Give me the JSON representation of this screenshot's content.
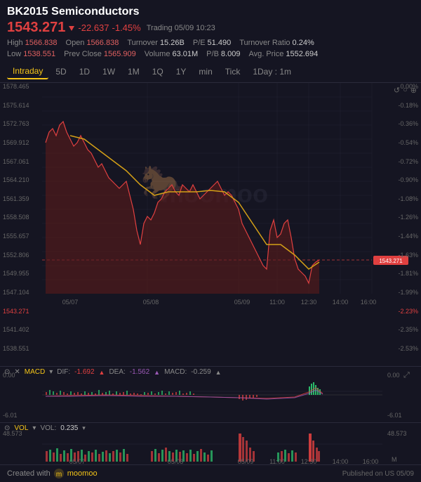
{
  "header": {
    "title": "BK2015 Semiconductors",
    "price": "1543.271",
    "change_amount": "-22.637",
    "change_pct": "-1.45%",
    "status": "Trading",
    "date_time": "05/09 10:23",
    "high_label": "High",
    "high_val": "1566.838",
    "low_label": "Low",
    "low_val": "1538.551",
    "open_label": "Open",
    "open_val": "1566.838",
    "prev_close_label": "Prev Close",
    "prev_close_val": "1565.909",
    "turnover_label": "Turnover",
    "turnover_val": "15.26B",
    "volume_label": "Volume",
    "volume_val": "63.01M",
    "pe_label": "P/E",
    "pe_val": "51.490",
    "pb_label": "P/B",
    "pb_val": "8.009",
    "turnover_ratio_label": "Turnover Ratio",
    "turnover_ratio_val": "0.24%",
    "avg_price_label": "Avg. Price",
    "avg_price_val": "1552.694"
  },
  "tabs": {
    "items": [
      "Intraday",
      "5D",
      "1D",
      "1W",
      "1M",
      "1Q",
      "1Y",
      "min",
      "Tick",
      "1Day : 1m"
    ],
    "active": "Intraday"
  },
  "chart": {
    "y_labels_left": [
      "1578.465",
      "1575.614",
      "1572.763",
      "1569.912",
      "1567.061",
      "1564.210",
      "1561.359",
      "1558.508",
      "1555.657",
      "1552.806",
      "1549.955",
      "1547.104",
      "1543.271 (dashed)",
      "1541.402",
      "1538.551"
    ],
    "y_labels_right": [
      "0.00%",
      "-0.18%",
      "-0.36%",
      "-0.54%",
      "-0.72%",
      "-0.90%",
      "-1.08%",
      "-1.26%",
      "-1.44%",
      "-1.63%",
      "-1.81%",
      "-1.99%",
      "-2.23%",
      "-2.35%",
      "-2.53%"
    ],
    "x_labels": [
      "05/07",
      "05/08",
      "05/09",
      "11:00",
      "12:30",
      "14:00",
      "16:00"
    ],
    "watermark": "moomoo",
    "reset_icons": [
      "↺",
      "○",
      "⊕"
    ],
    "current_price": "1543.271"
  },
  "macd_panel": {
    "title": "MACD",
    "dif_label": "DIF:",
    "dif_val": "-1.692",
    "dea_label": "DEA:",
    "dea_val": "-1.562",
    "macd_label": "MACD:",
    "macd_val": "-0.259",
    "y_label_top": "0.00",
    "y_label_bottom": "-6.01",
    "expand_icon": "⤢"
  },
  "vol_panel": {
    "title": "VOL",
    "vol_label": "VOL:",
    "vol_val": "0.235",
    "y_label_top": "48.573",
    "y_label_bottom": "M",
    "x_labels": [
      "05/07",
      "05/08",
      "05/09",
      "11:00",
      "12:30",
      "14:00",
      "16:00"
    ]
  },
  "footer": {
    "created_with": "Created with",
    "logo_text": "moomoo",
    "published": "Published on US 05/09"
  }
}
